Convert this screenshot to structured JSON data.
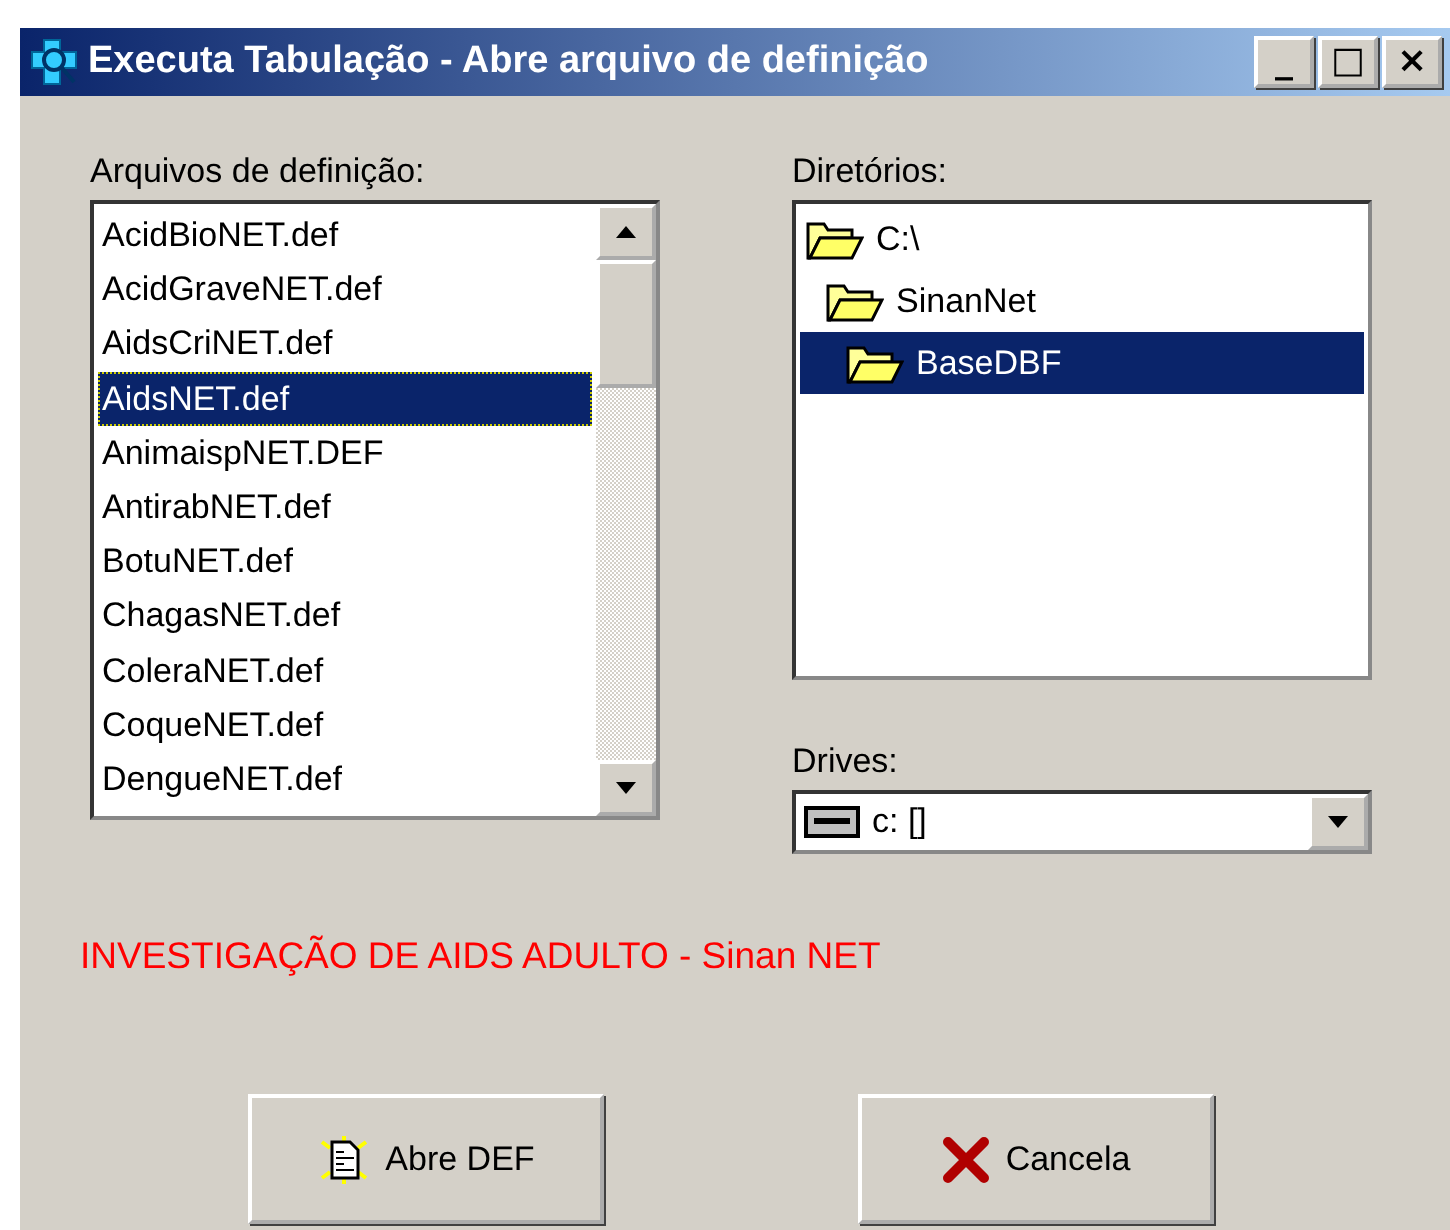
{
  "window": {
    "title": "Executa Tabulação - Abre arquivo de definição",
    "controls": [
      "_",
      "□",
      "×"
    ]
  },
  "files": {
    "label": "Arquivos de definição:",
    "items": [
      {
        "text": "AcidBioNET.def",
        "selected": false
      },
      {
        "text": "AcidGraveNET.def",
        "selected": false
      },
      {
        "text": "AidsCriNET.def",
        "selected": false
      },
      {
        "text": "AidsNET.def",
        "selected": true
      },
      {
        "text": "AnimaispNET.DEF",
        "selected": false
      },
      {
        "text": "AntirabNET.def",
        "selected": false
      },
      {
        "text": "BotuNET.def",
        "selected": false
      },
      {
        "text": "ChagasNET.def",
        "selected": false
      },
      {
        "text": "ColeraNET.def",
        "selected": false
      },
      {
        "text": "CoqueNET.def",
        "selected": false
      },
      {
        "text": "DengueNET.def",
        "selected": false
      }
    ]
  },
  "directories": {
    "label": "Diretórios:",
    "tree": [
      {
        "text": "C:\\",
        "selected": false,
        "children": [
          {
            "text": "SinanNet",
            "selected": false,
            "children": [
              {
                "text": "BaseDBF",
                "selected": true
              }
            ]
          }
        ]
      }
    ]
  },
  "drives": {
    "label": "Drives:",
    "value": "c: []"
  },
  "message": "INVESTIGAÇÃO DE AIDS ADULTO - Sinan NET",
  "buttons": [
    {
      "kind": "open",
      "label": "Abre DEF"
    },
    {
      "kind": "cancel",
      "label": "Cancela"
    }
  ]
}
